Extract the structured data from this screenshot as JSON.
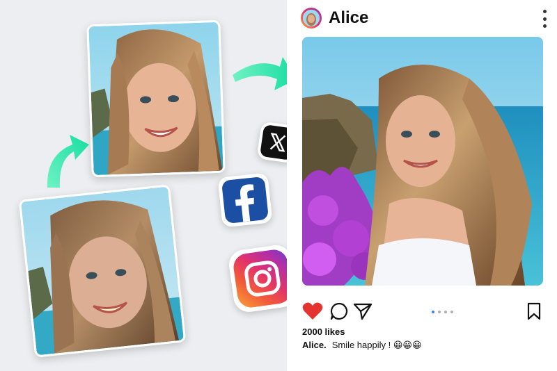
{
  "post": {
    "username": "Alice",
    "likes": "2000 likes",
    "caption_user": "Alice.",
    "caption_text": "Smile happily ! 😀😀😀",
    "carousel_dots": 4,
    "active_dot": 0
  },
  "icons": {
    "more": "more-vertical-icon",
    "like": "heart-icon",
    "comment": "comment-icon",
    "share": "send-icon",
    "save": "bookmark-icon",
    "x": "x-logo-icon",
    "facebook": "facebook-logo-icon",
    "instagram": "instagram-logo-icon"
  },
  "colors": {
    "accent_arrow": "#2ee6b0",
    "like_red": "#e3342f",
    "facebook_blue": "#1a4fa3",
    "carousel_active": "#3b82f6"
  }
}
